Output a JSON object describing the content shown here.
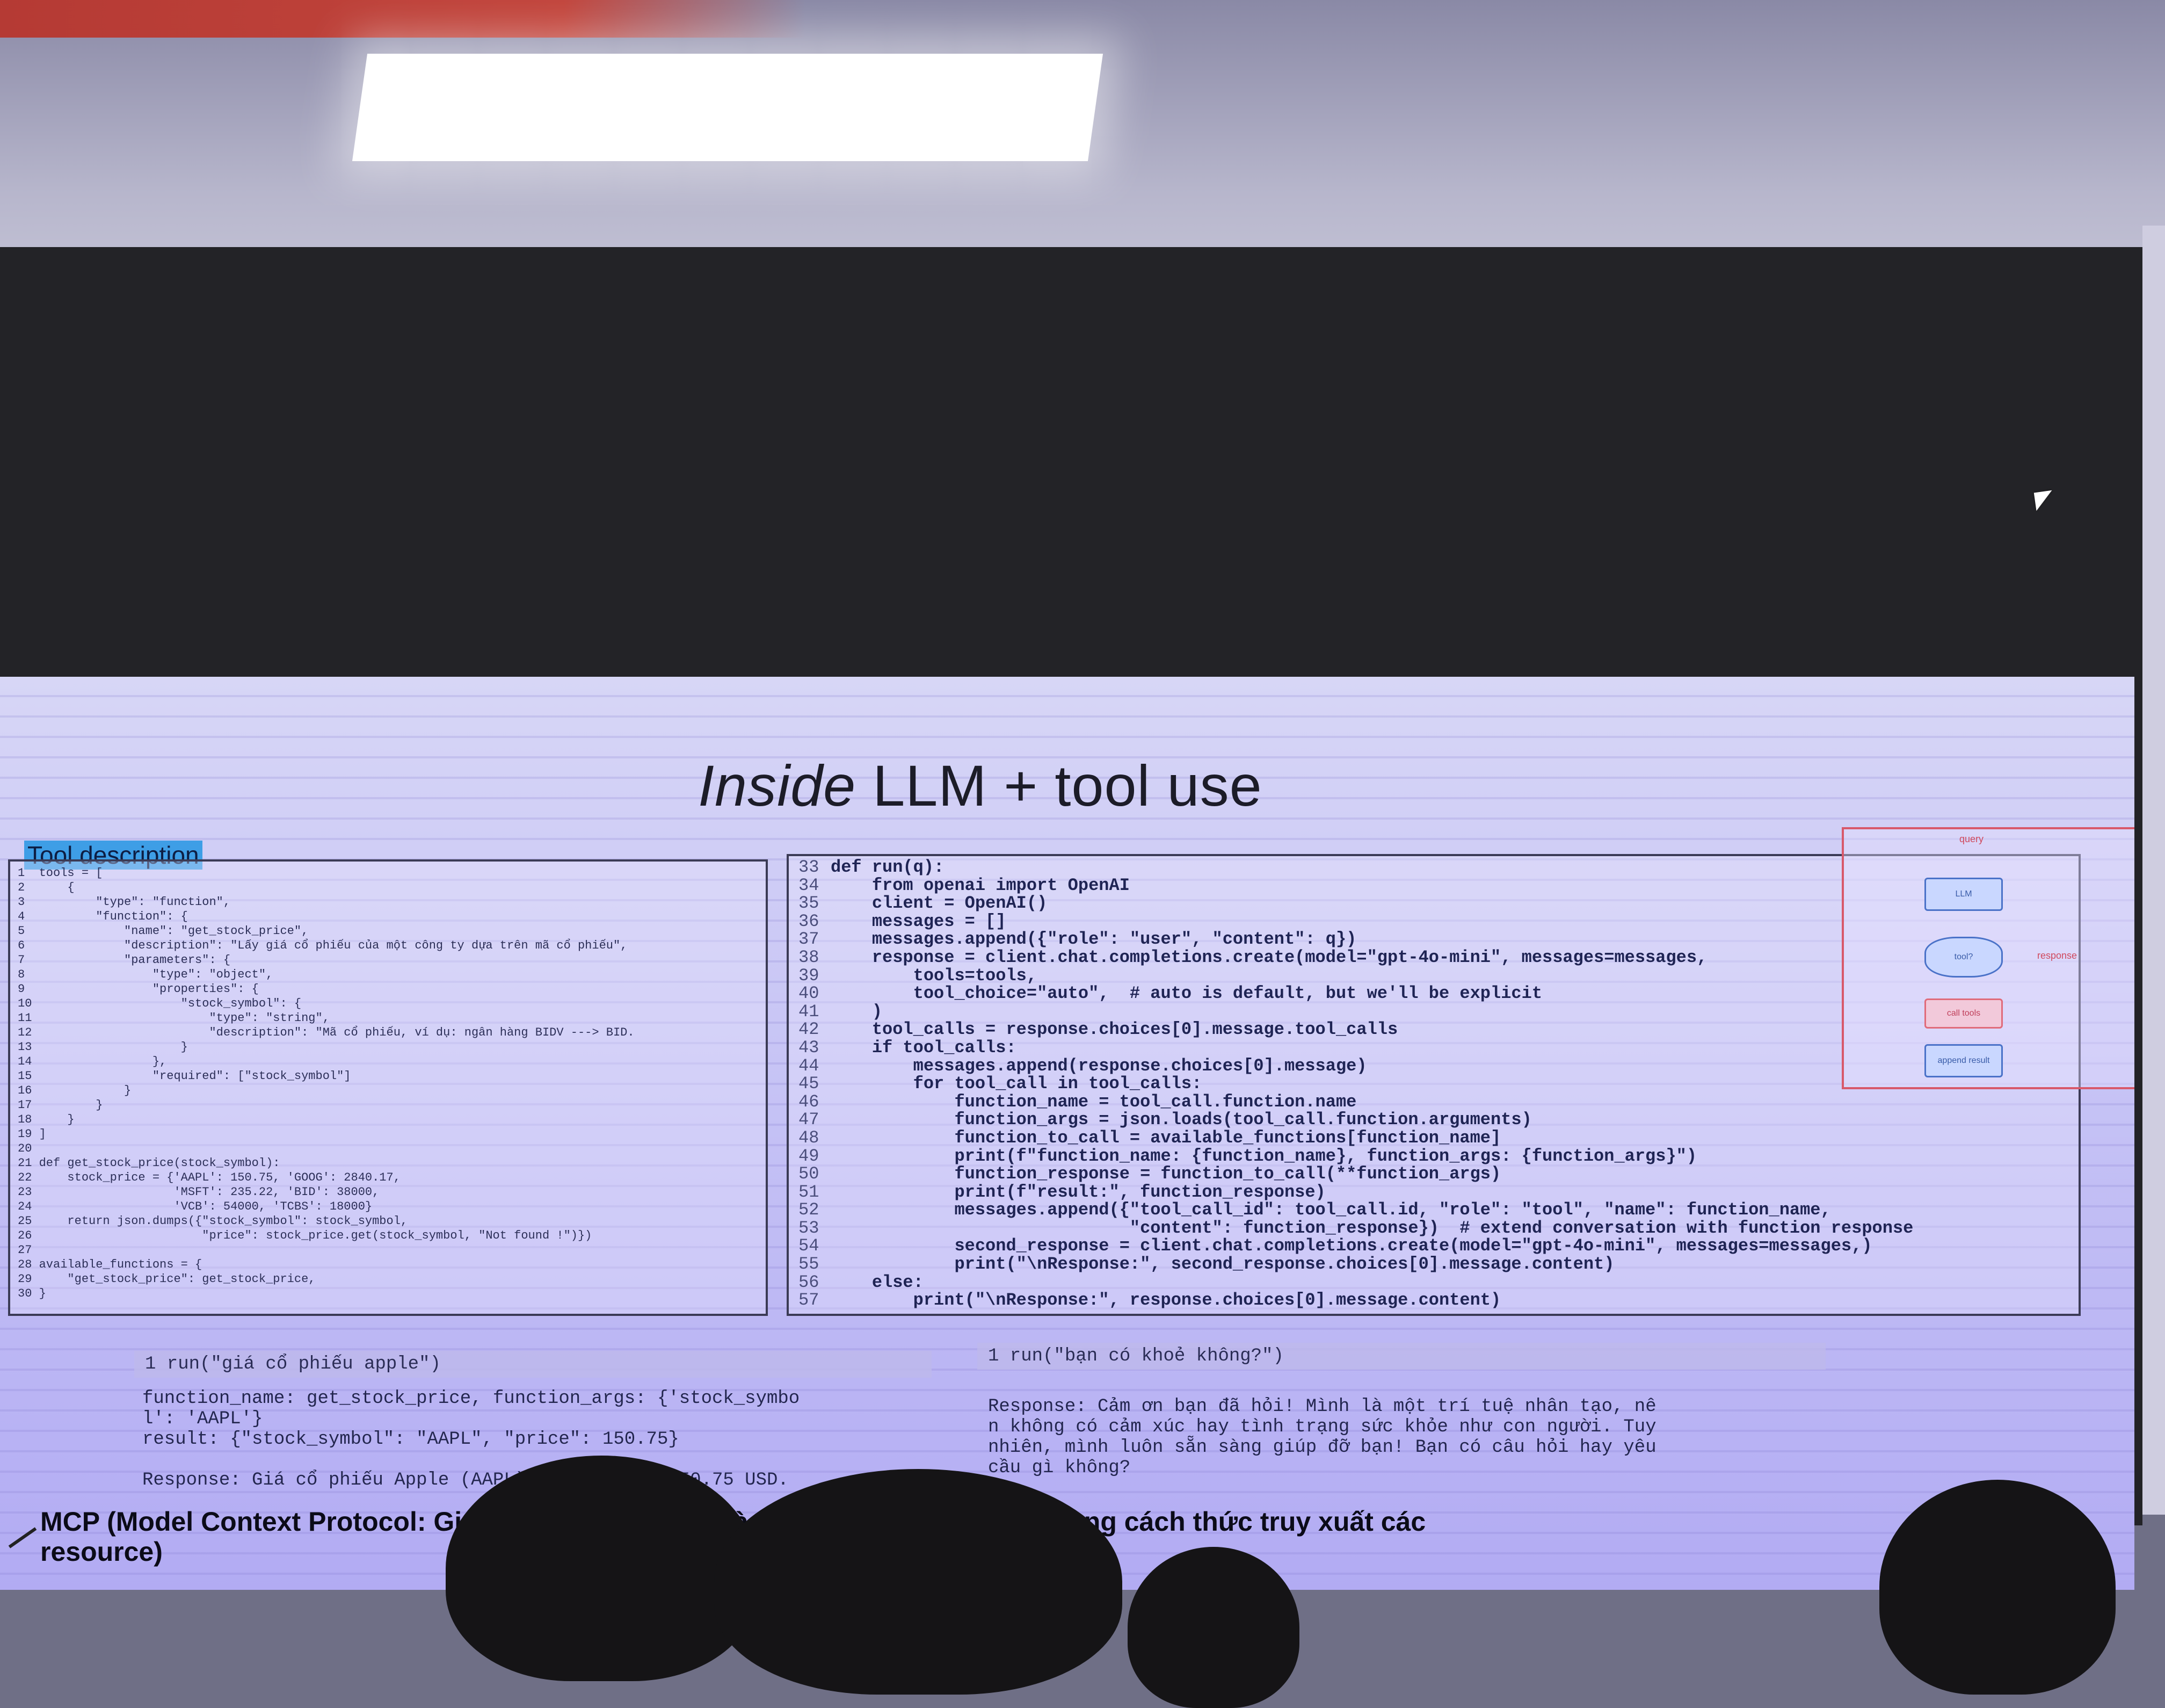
{
  "slide": {
    "title_italic": "Inside",
    "title_rest": " LLM  + tool use",
    "section_label": "Tool description",
    "left_code": [
      "1  tools = [",
      "2      {",
      "3          \"type\": \"function\",",
      "4          \"function\": {",
      "5              \"name\": \"get_stock_price\",",
      "6              \"description\": \"Lấy giá cổ phiếu của một công ty dựa trên mã cổ phiếu\",",
      "7              \"parameters\": {",
      "8                  \"type\": \"object\",",
      "9                  \"properties\": {",
      "10                     \"stock_symbol\": {",
      "11                         \"type\": \"string\",",
      "12                         \"description\": \"Mã cổ phiếu, ví dụ: ngân hàng BIDV ---> BID.",
      "13                     }",
      "14                 },",
      "15                 \"required\": [\"stock_symbol\"]",
      "16             }",
      "17         }",
      "18     }",
      "19 ]",
      "20",
      "21 def get_stock_price(stock_symbol):",
      "22     stock_price = {'AAPL': 150.75, 'GOOG': 2840.17,",
      "23                    'MSFT': 235.22, 'BID': 38000,",
      "24                    'VCB': 54000, 'TCBS': 18000}",
      "25     return json.dumps({\"stock_symbol\": stock_symbol,",
      "26                        \"price\": stock_price.get(stock_symbol, \"Not found !\")})",
      "27",
      "28 available_functions = {",
      "29     \"get_stock_price\": get_stock_price,",
      "30 }"
    ],
    "right_code": [
      {
        "n": "33",
        "t": "def run(q):"
      },
      {
        "n": "34",
        "t": "    from openai import OpenAI"
      },
      {
        "n": "35",
        "t": "    client = OpenAI()"
      },
      {
        "n": "36",
        "t": "    messages = []"
      },
      {
        "n": "37",
        "t": "    messages.append({\"role\": \"user\", \"content\": q})"
      },
      {
        "n": "38",
        "t": "    response = client.chat.completions.create(model=\"gpt-4o-mini\", messages=messages,"
      },
      {
        "n": "39",
        "t": "        tools=tools,"
      },
      {
        "n": "40",
        "t": "        tool_choice=\"auto\",  # auto is default, but we'll be explicit"
      },
      {
        "n": "41",
        "t": "    )"
      },
      {
        "n": "42",
        "t": "    tool_calls = response.choices[0].message.tool_calls"
      },
      {
        "n": "43",
        "t": "    if tool_calls:"
      },
      {
        "n": "44",
        "t": "        messages.append(response.choices[0].message)"
      },
      {
        "n": "45",
        "t": "        for tool_call in tool_calls:"
      },
      {
        "n": "46",
        "t": "            function_name = tool_call.function.name"
      },
      {
        "n": "47",
        "t": "            function_args = json.loads(tool_call.function.arguments)"
      },
      {
        "n": "48",
        "t": "            function_to_call = available_functions[function_name]"
      },
      {
        "n": "49",
        "t": "            print(f\"function_name: {function_name}, function_args: {function_args}\")"
      },
      {
        "n": "50",
        "t": "            function_response = function_to_call(**function_args)"
      },
      {
        "n": "51",
        "t": "            print(f\"result:\", function_response)"
      },
      {
        "n": "52",
        "t": "            messages.append({\"tool_call_id\": tool_call.id, \"role\": \"tool\", \"name\": function_name,"
      },
      {
        "n": "53",
        "t": "                             \"content\": function_response})  # extend conversation with function response"
      },
      {
        "n": "54",
        "t": "            second_response = client.chat.completions.create(model=\"gpt-4o-mini\", messages=messages,)"
      },
      {
        "n": "55",
        "t": "            print(\"\\nResponse:\", second_response.choices[0].message.content)"
      },
      {
        "n": "56",
        "t": "    else:"
      },
      {
        "n": "57",
        "t": "        print(\"\\nResponse:\", response.choices[0].message.content)"
      }
    ],
    "flow": {
      "query_label": "query",
      "llm_node": "LLM",
      "decision_node": "tool?",
      "response_label": "response",
      "call_node": "call tools",
      "append_node": "append result"
    },
    "run_left": "1  run(\"giá cổ phiếu apple\")",
    "output_left": "function_name: get_stock_price, function_args: {'stock_symbo\nl': 'AAPL'}\nresult: {\"stock_symbol\": \"AAPL\", \"price\": 150.75}\n\nResponse: Giá cổ phiếu Apple (AAPL) hiện tại là 150.75 USD.",
    "run_right": "1  run(\"bạn có khoẻ không?\")",
    "output_right": "Response: Cảm ơn bạn đã hỏi! Mình là một trí tuệ nhân tạo, nê\nn không có cảm xúc hay tình trạng sức khỏe như con người. Tuy\nnhiên, mình luôn sẵn sàng giúp đỡ bạn! Bạn có câu hỏi hay yêu\ncầu gì không?",
    "mcp_line1": "MCP (Model Context Protocol: Giao thức chuẩn hoá mà cho phép các LLM có chung cách thức truy xuất các",
    "mcp_line2": "resource)"
  },
  "colors": {
    "slide_bg": "#c6c3f5",
    "code_text": "#1f2454",
    "section_highlight": "#3e9ee6",
    "flow_border": "#d8596b"
  }
}
